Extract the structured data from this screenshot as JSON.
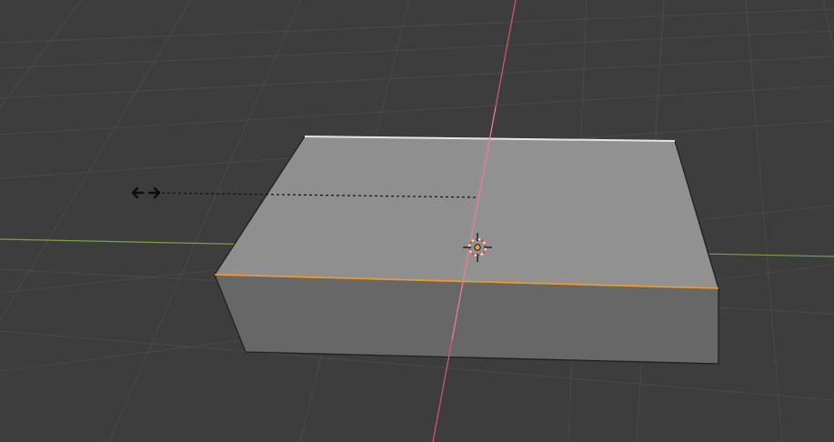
{
  "app": {
    "view": "3d-viewport",
    "mode": "edit-mode",
    "select_mode": "edge"
  },
  "viewport": {
    "background_color": "#3d3d3d",
    "grid_color": "#4a4a4a",
    "x_axis_color": "#d85a66",
    "y_axis_color": "#7ba33c"
  },
  "object": {
    "type": "cube",
    "top_face_color": "#8f8f8f",
    "front_face_color": "#676767",
    "selected_edge_color": "#f39a29",
    "edge_color": "#1f1f1f"
  },
  "transform": {
    "operation": "scale",
    "cursor_icon": "scale-arrows-icon",
    "pivot_icon": "3d-cursor-icon",
    "pivot_color": "#e0a33a"
  }
}
